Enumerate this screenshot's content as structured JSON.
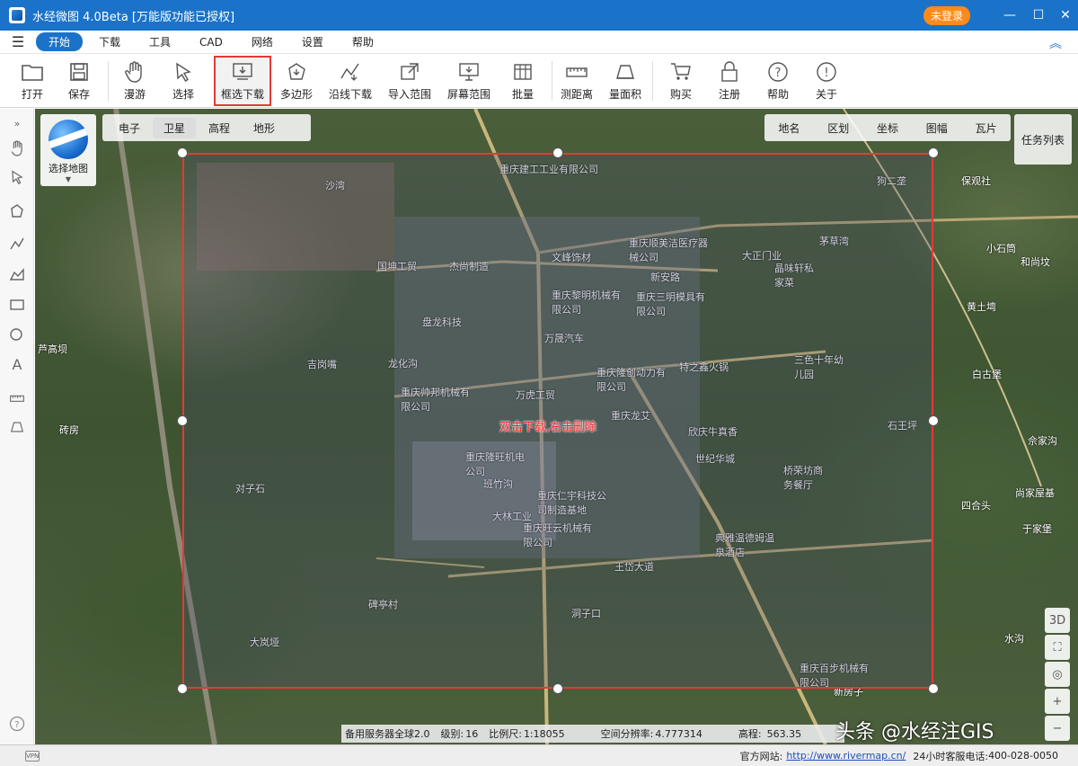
{
  "window": {
    "title": "水经微图 4.0Beta [万能版功能已授权]",
    "login_label": "未登录",
    "minimize": "—",
    "maximize": "☐",
    "close": "✕"
  },
  "menu": {
    "items": [
      "开始",
      "下载",
      "工具",
      "CAD",
      "网络",
      "设置",
      "帮助"
    ],
    "active": "开始"
  },
  "toolbar": {
    "buttons": [
      {
        "label": "打开",
        "icon": "folder-icon"
      },
      {
        "label": "保存",
        "icon": "save-icon"
      },
      {
        "label": "漫游",
        "icon": "hand-icon"
      },
      {
        "label": "选择",
        "icon": "cursor-icon"
      },
      {
        "label": "框选下载",
        "icon": "box-download-icon"
      },
      {
        "label": "多边形",
        "icon": "polygon-icon"
      },
      {
        "label": "沿线下载",
        "icon": "line-download-icon"
      },
      {
        "label": "导入范围",
        "icon": "import-icon"
      },
      {
        "label": "屏幕范围",
        "icon": "screen-icon"
      },
      {
        "label": "批量",
        "icon": "batch-icon"
      },
      {
        "label": "测距离",
        "icon": "ruler-icon"
      },
      {
        "label": "量面积",
        "icon": "area-icon"
      },
      {
        "label": "购买",
        "icon": "cart-icon"
      },
      {
        "label": "注册",
        "icon": "lock-icon"
      },
      {
        "label": "帮助",
        "icon": "help-icon"
      },
      {
        "label": "关于",
        "icon": "info-icon"
      }
    ],
    "selected": "框选下载"
  },
  "map": {
    "layer_tabs": [
      "电子",
      "卫星",
      "高程",
      "地形"
    ],
    "active_layer": "卫星",
    "select_map_label": "选择地图",
    "right_tabs": [
      "地名",
      "区划",
      "坐标",
      "图幅",
      "瓦片"
    ],
    "task_list_label": "任务列表",
    "hint": "双击下载,右击删除",
    "labels": [
      "重庆建工工业有限公司",
      "沙湾",
      "狗二垄",
      "保观社",
      "茅草湾",
      "重庆顺美洁医疗器械公司",
      "大正门业",
      "国坤工贸",
      "杰尚制造",
      "文峰饰材",
      "晶味轩私家菜",
      "新安路",
      "重庆黎明机械有限公司",
      "重庆三明模具有限公司",
      "小石筒",
      "和尚坟",
      "黄土塆",
      "盘龙科技",
      "芦高坝",
      "万晟汽车",
      "吉岗嘴",
      "龙化沟",
      "重庆隆创动力有限公司",
      "特之鑫火锅",
      "三色十年幼儿园",
      "白古堡",
      "重庆帅邦机械有限公司",
      "万虎工贸",
      "重庆龙艾",
      "石王坪",
      "砖房",
      "欣庆牛真香",
      "世纪华城",
      "佘家沟",
      "重庆隆旺机电公司",
      "桥荣坊商务餐厅",
      "对子石",
      "班竹沟",
      "重庆仁宇科技公司制造基地",
      "四合头",
      "尚家屋基",
      "大林工业",
      "重庆旺云机械有限公司",
      "典雅温德姆温泉酒店",
      "于家堡",
      "王岱大道",
      "碑亭村",
      "洞子口",
      "大岚垭",
      "重庆百步机械有限公司",
      "新房子",
      "水沟"
    ],
    "controls": [
      "3D"
    ]
  },
  "info_bar": {
    "server": "备用服务器全球2.0",
    "level_label": "级别:",
    "level": "16",
    "scale_label": "比例尺:",
    "scale": "1:18055",
    "resolution_label": "空间分辨率:",
    "resolution": "4.777314",
    "elevation_label": "高程:",
    "elevation": "563.35"
  },
  "watermark": "头条 @水经注GIS",
  "status_bar": {
    "vpn": "VPN",
    "website_label": "官方网站:",
    "website": "http://www.rivermap.cn/",
    "hotline_label": "24小时客服电话:",
    "hotline": "400-028-0050"
  }
}
